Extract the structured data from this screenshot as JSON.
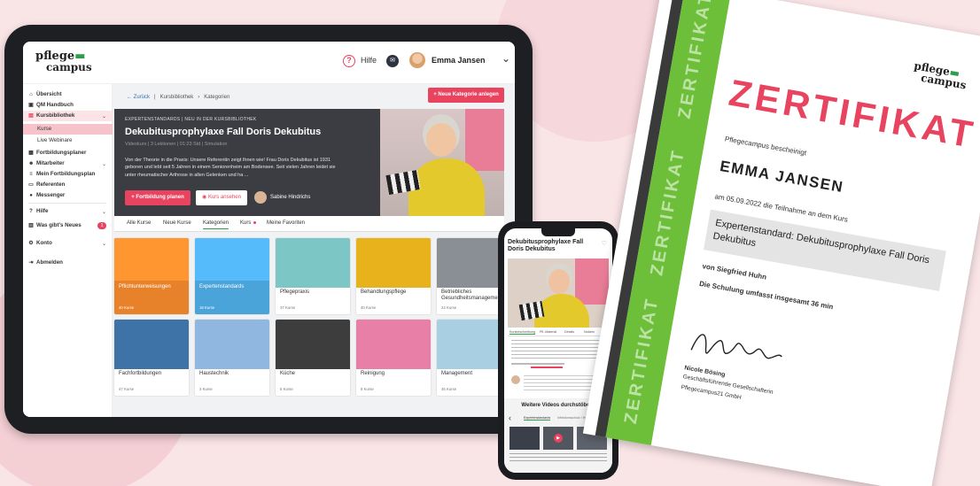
{
  "tablet": {
    "logo": {
      "line1": "pflege",
      "line2": "campus"
    },
    "header": {
      "help_label": "Hilfe",
      "user_name": "Emma Jansen"
    },
    "sidebar": {
      "items": [
        {
          "label": "Übersicht",
          "icon": "home-icon"
        },
        {
          "label": "QM Handbuch",
          "icon": "book-icon"
        },
        {
          "label": "Kursbibliothek",
          "icon": "library-icon"
        },
        {
          "label": "Kurse",
          "icon": ""
        },
        {
          "label": "Live Webinare",
          "icon": ""
        },
        {
          "label": "Fortbildungsplaner",
          "icon": "calendar-icon"
        },
        {
          "label": "Mitarbeiter",
          "icon": "people-icon"
        },
        {
          "label": "Mein Fortbildungsplan",
          "icon": "list-icon"
        },
        {
          "label": "Referenten",
          "icon": "presenter-icon"
        },
        {
          "label": "Messenger",
          "icon": "chat-icon"
        },
        {
          "label": "Hilfe",
          "icon": "help-icon"
        },
        {
          "label": "Was gibt's Neues",
          "icon": "news-icon",
          "badge": "1"
        },
        {
          "label": "Konto",
          "icon": "settings-icon"
        },
        {
          "label": "Abmelden",
          "icon": "logout-icon"
        }
      ]
    },
    "breadcrumb": {
      "back": "← Zurück",
      "sep": "|",
      "crumb1": "Kursbibliothek",
      "crumb2": "Kategorien"
    },
    "new_category_button": "+ Neue Kategorie anlegen",
    "hero": {
      "kicker": "EXPERTENSTANDARDS  |  NEU IN DER KURSBIBLIOTHEK",
      "title": "Dekubitusprophylaxe Fall Doris Dekubitus",
      "meta": "Videokurs  |  3 Lektionen  |  01:23 Std  |  Simulation",
      "description": "Von der Theorie in die Praxis: Unsere Referentin zeigt Ihnen wie! Frau Doris Dekubitus ist 1931 geboren und lebt seit 5 Jahren in einem Seniorenheim am Bodensee. Seit vielen Jahren leidet sie unter rheumatischer Arthrose in allen Gelenken und ha ...",
      "plan_button": "+ Fortbildung planen",
      "view_button": "Kurs ansehen",
      "speaker": "Sabine Hindrichs"
    },
    "tabs": [
      "Alle Kurse",
      "Neue Kurse",
      "Kategorien",
      "Kurs",
      "Meine Favoriten"
    ],
    "cards": [
      {
        "title": "Pflichtunterweisungen",
        "count": "40 Kurse",
        "color": "#e8822a"
      },
      {
        "title": "Expertenstandards",
        "count": "18 Kurse",
        "color": "#4aa3d9"
      },
      {
        "title": "Pflegepraxis",
        "count": "37 Kurse",
        "color": "#7cc7c5"
      },
      {
        "title": "Behandlungspflege",
        "count": "40 Kurse",
        "color": "#e8b21c"
      },
      {
        "title": "Betriebliches Gesundheitsmanagement",
        "count": "24 Kurse",
        "color": "#8a8f96"
      },
      {
        "title": "Fachfortbildungen",
        "count": "47 Kurse",
        "color": "#3e73a8"
      },
      {
        "title": "Haustechnik",
        "count": "3 Kurse",
        "color": "#8fb7e0"
      },
      {
        "title": "Küche",
        "count": "5 Kurse",
        "color": "#3d3d3d"
      },
      {
        "title": "Reinigung",
        "count": "8 Kurse",
        "color": "#e87fa6"
      },
      {
        "title": "Management",
        "count": "45 Kurse",
        "color": "#a9cfe2"
      }
    ]
  },
  "phone": {
    "title": "Dekubitusprophylaxe Fall Doris Dekubitus",
    "tabs": [
      "Kursbeschreibung",
      "Pfl.-Material",
      "Details",
      "Notizen"
    ],
    "more_videos": "Weitere Videos durchstöbern",
    "filter1": "Expertenstandards",
    "filter2": "Infektionsschutz / Hyg..."
  },
  "certificate": {
    "logo": {
      "line1": "pflege",
      "line2": "campus"
    },
    "heading": "ZERTIFIKAT",
    "intro": "Pflegecampus bescheinigt",
    "name": "EMMA JANSEN",
    "date_line": "am 05.09.2022 die Teilnahme an dem Kurs",
    "course": "Expertenstandard: Dekubitusprophylaxe Fall Doris Dekubitus",
    "by": "von Siegfried Huhn",
    "duration": "Die Schulung umfasst insgesamt 36 min",
    "signer": "Nicole Bösing",
    "role": "Geschäftsführende Gesellschafterin",
    "company": "Pflegecampus21 GmbH",
    "side_text": "ZERTIFIKAT"
  },
  "colors": {
    "brand_pink": "#e8435f",
    "brand_green": "#6dbf3a"
  }
}
